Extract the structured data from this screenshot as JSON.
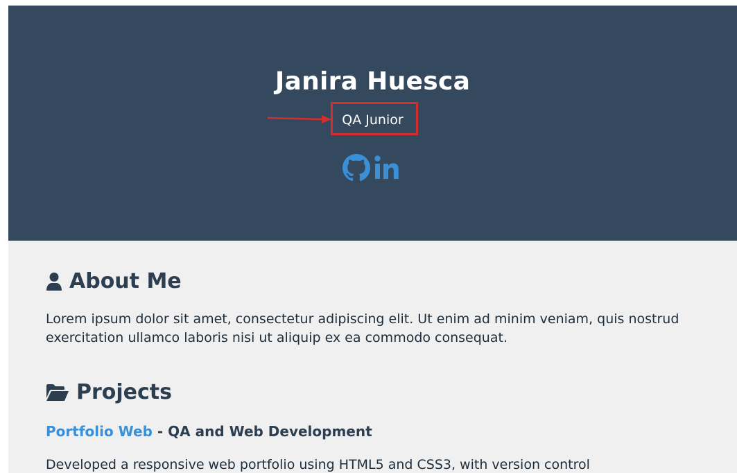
{
  "header": {
    "name": "Janira Huesca",
    "subtitle": "QA Junior",
    "social": [
      {
        "icon": "github-icon",
        "color": "#3a8fd6"
      },
      {
        "icon": "linkedin-icon",
        "color": "#3a8fd6"
      }
    ]
  },
  "about": {
    "icon": "user-icon",
    "title": "About Me",
    "text": "Lorem ipsum dolor sit amet, consectetur adipiscing elit. Ut enim ad minim veniam, quis nostrud exercitation ullamco laboris nisi ut aliquip ex ea commodo consequat."
  },
  "projects": {
    "icon": "folder-open-icon",
    "title": "Projects",
    "items": [
      {
        "link_label": "Portfolio Web",
        "separator": " - ",
        "subtitle": "QA and Web Development",
        "description": "Developed a responsive web portfolio using HTML5 and CSS3, with version control"
      }
    ]
  },
  "colors": {
    "header_bg": "#34495e",
    "accent": "#3a8fd6",
    "annotation": "#d32f2f",
    "main_bg": "#f0f0f0"
  }
}
